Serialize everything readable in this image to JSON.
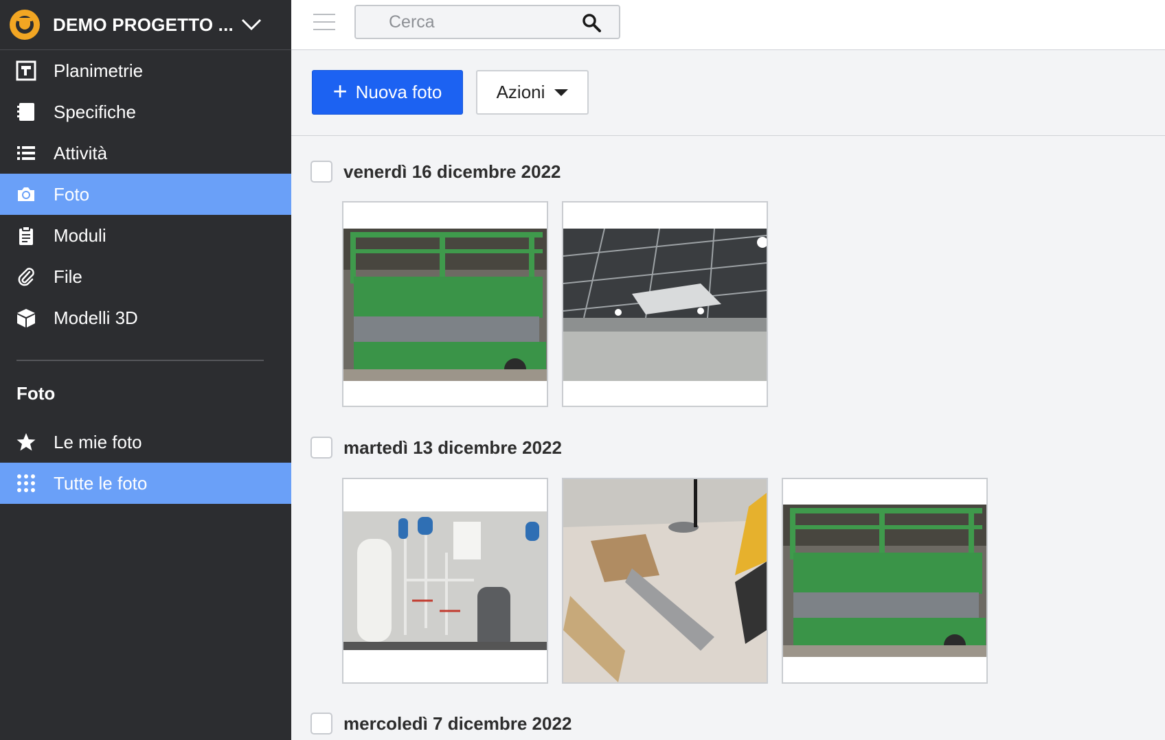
{
  "project": {
    "name": "DEMO PROGETTO ...",
    "logo_icon": "hardhat-logo-icon",
    "chevron_icon": "chevron-down-icon"
  },
  "nav": [
    {
      "label": "Planimetrie",
      "icon": "floorplan-icon"
    },
    {
      "label": "Specifiche",
      "icon": "book-icon"
    },
    {
      "label": "Attività",
      "icon": "list-icon"
    },
    {
      "label": "Foto",
      "icon": "camera-icon",
      "active": true
    },
    {
      "label": "Moduli",
      "icon": "clipboard-icon"
    },
    {
      "label": "File",
      "icon": "paperclip-icon"
    },
    {
      "label": "Modelli 3D",
      "icon": "cube-icon"
    }
  ],
  "section": {
    "title": "Foto"
  },
  "subnav": [
    {
      "label": "Le mie foto",
      "icon": "star-icon"
    },
    {
      "label": "Tutte le foto",
      "icon": "grid-dots-icon",
      "active": true
    }
  ],
  "search": {
    "placeholder": "Cerca",
    "icon": "search-icon"
  },
  "toolbar": {
    "new_label": "Nuova foto",
    "actions_label": "Azioni"
  },
  "groups": [
    {
      "date": "venerdì 16 dicembre 2022",
      "photos": [
        "lift",
        "ceiling"
      ]
    },
    {
      "date": "martedì 13 dicembre 2022",
      "photos": [
        "boiler",
        "debris",
        "lift"
      ]
    },
    {
      "date": "mercoledì 7 dicembre 2022",
      "photos": []
    }
  ],
  "colors": {
    "sidebar_bg": "#2c2d30",
    "active_bg": "#6aa0f8",
    "primary": "#1c62f2",
    "logo": "#f2a623"
  }
}
